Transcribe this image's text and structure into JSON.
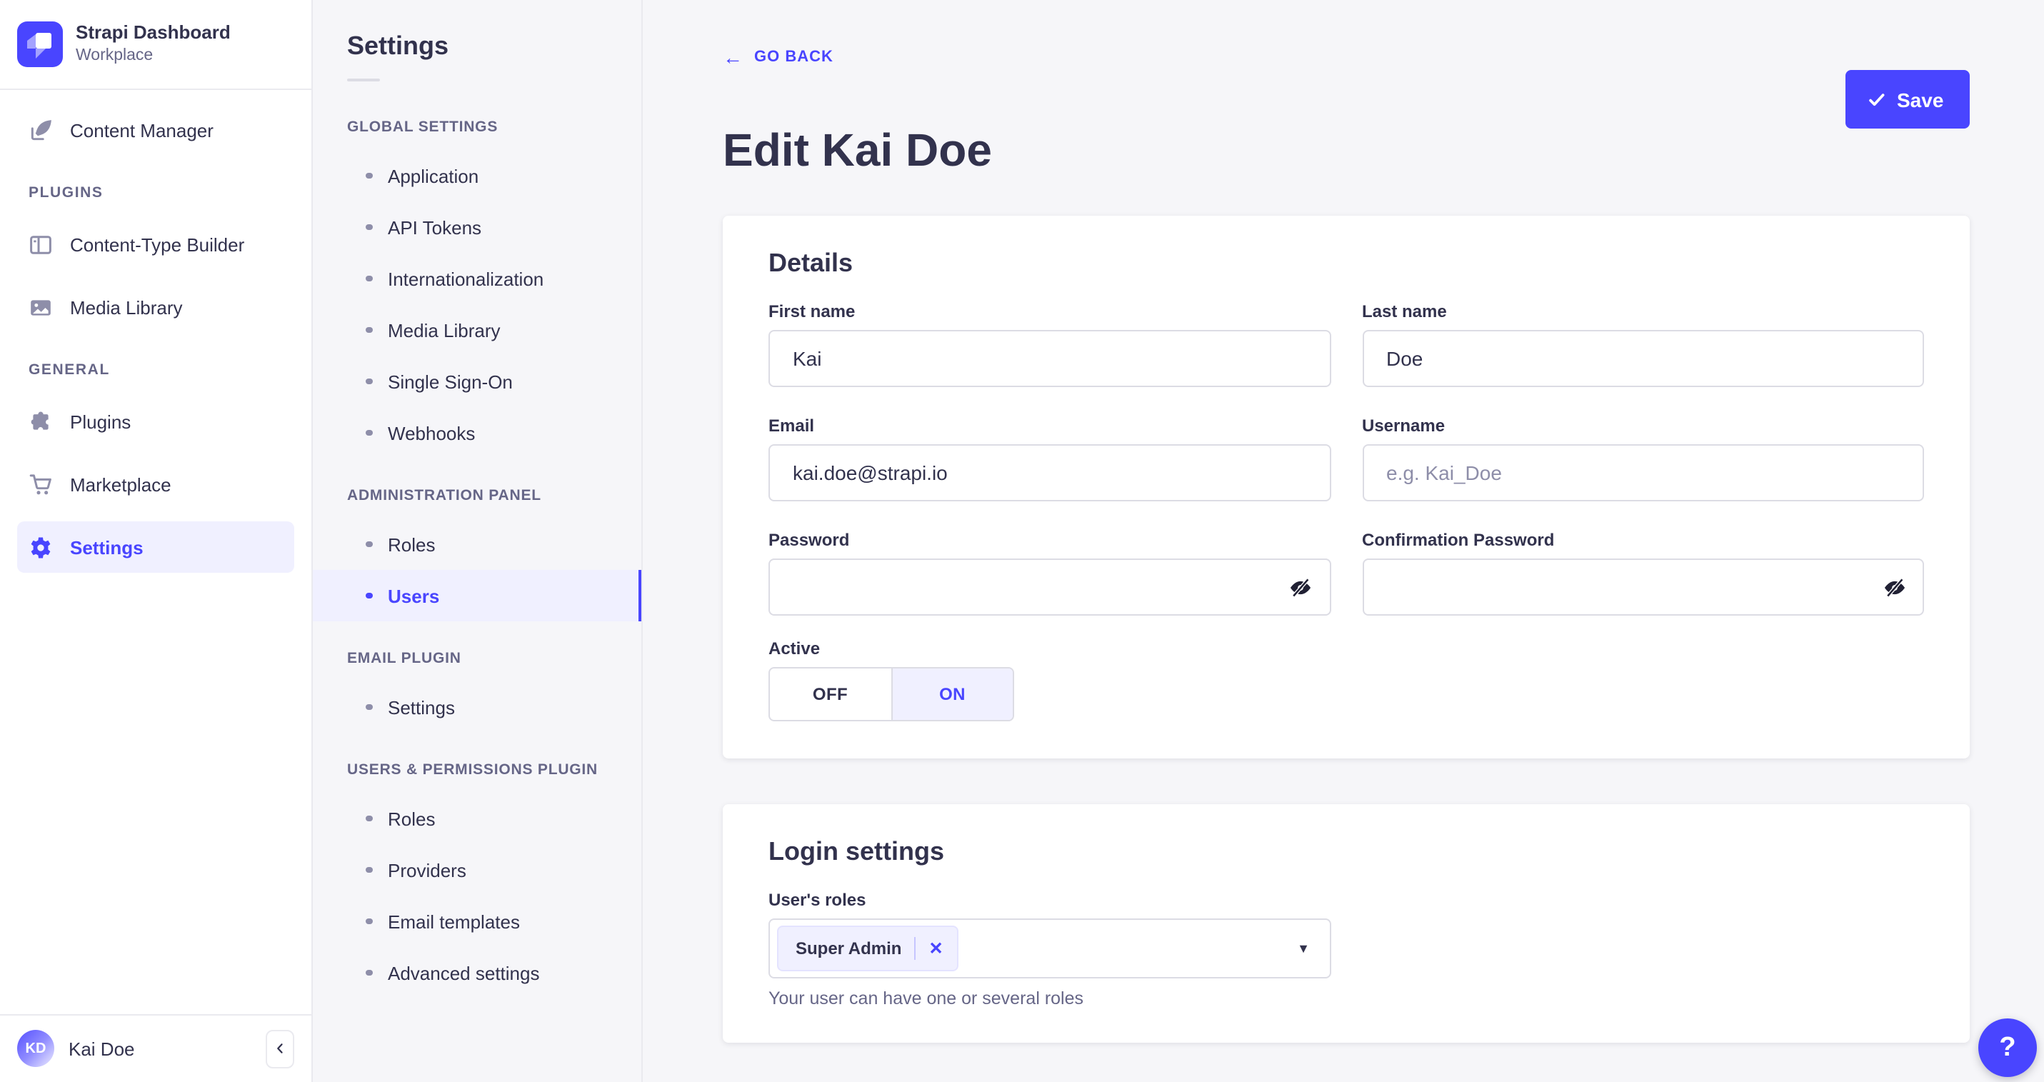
{
  "colors": {
    "primary": "#4945ff",
    "primary_light_bg": "#f0f0ff",
    "text_dark": "#32324d",
    "text_muted": "#666687",
    "input_border": "#dcdce4",
    "app_bg": "#f6f6f9",
    "card_bg": "#ffffff"
  },
  "brand": {
    "title": "Strapi Dashboard",
    "subtitle": "Workplace"
  },
  "sidebar": {
    "primary_item": {
      "label": "Content Manager"
    },
    "sections": [
      {
        "label": "PLUGINS",
        "items": [
          {
            "label": "Content-Type Builder"
          },
          {
            "label": "Media Library"
          }
        ]
      },
      {
        "label": "GENERAL",
        "items": [
          {
            "label": "Plugins"
          },
          {
            "label": "Marketplace"
          },
          {
            "label": "Settings",
            "active": true
          }
        ]
      }
    ],
    "footer": {
      "initials": "KD",
      "name": "Kai Doe"
    }
  },
  "subnav": {
    "title": "Settings",
    "sections": [
      {
        "label": "GLOBAL SETTINGS",
        "items": [
          "Application",
          "API Tokens",
          "Internationalization",
          "Media Library",
          "Single Sign-On",
          "Webhooks"
        ]
      },
      {
        "label": "ADMINISTRATION PANEL",
        "items": [
          "Roles",
          "Users"
        ],
        "active_item": "Users"
      },
      {
        "label": "EMAIL PLUGIN",
        "items": [
          "Settings"
        ]
      },
      {
        "label": "USERS & PERMISSIONS PLUGIN",
        "items": [
          "Roles",
          "Providers",
          "Email templates",
          "Advanced settings"
        ]
      }
    ]
  },
  "header": {
    "back_label": "GO BACK",
    "back_arrow": "←",
    "title": "Edit Kai Doe",
    "save_label": "Save"
  },
  "details": {
    "title": "Details",
    "fields": {
      "first_name": {
        "label": "First name",
        "value": "Kai"
      },
      "last_name": {
        "label": "Last name",
        "value": "Doe"
      },
      "email": {
        "label": "Email",
        "value": "kai.doe@strapi.io"
      },
      "username": {
        "label": "Username",
        "value": "",
        "placeholder": "e.g. Kai_Doe"
      },
      "password": {
        "label": "Password",
        "value": ""
      },
      "confirmation_password": {
        "label": "Confirmation Password",
        "value": ""
      }
    },
    "active_toggle": {
      "label": "Active",
      "off_label": "OFF",
      "on_label": "ON",
      "value": "ON"
    }
  },
  "login": {
    "title": "Login settings",
    "roles_label": "User's roles",
    "selected_roles": [
      {
        "name": "Super Admin",
        "remove_label": "✕"
      }
    ],
    "caret": "▼",
    "helper": "Your user can have one or several roles"
  },
  "help": {
    "label": "?"
  }
}
